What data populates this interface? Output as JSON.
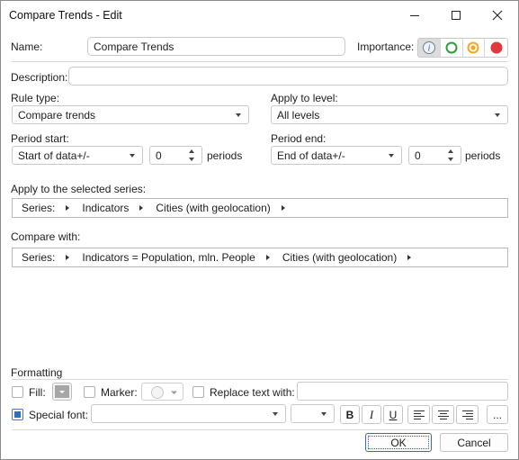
{
  "window": {
    "title": "Compare Trends - Edit"
  },
  "name": {
    "label": "Name:",
    "value": "Compare Trends"
  },
  "importance": {
    "label": "Importance:",
    "options": [
      "info",
      "green",
      "orange",
      "red"
    ]
  },
  "description": {
    "label": "Description:",
    "value": ""
  },
  "rule_type": {
    "label": "Rule type:",
    "value": "Compare trends"
  },
  "apply_level": {
    "label": "Apply to level:",
    "value": "All levels"
  },
  "period_start": {
    "label": "Period start:",
    "mode": "Start of data+/-",
    "value": "0",
    "unit": "periods"
  },
  "period_end": {
    "label": "Period end:",
    "mode": "End of data+/-",
    "value": "0",
    "unit": "periods"
  },
  "apply_series": {
    "label": "Apply to the selected series:",
    "segments": [
      "Series:",
      "Indicators",
      "Cities (with geolocation)"
    ]
  },
  "compare_with": {
    "label": "Compare with:",
    "segments": [
      "Series:",
      "Indicators = Population, mln. People",
      "Cities (with geolocation)"
    ]
  },
  "formatting": {
    "label": "Formatting",
    "fill_label": "Fill:",
    "marker_label": "Marker:",
    "replace_label": "Replace text with:",
    "replace_value": "",
    "special_font_label": "Special font:",
    "font_name": "",
    "font_size": "",
    "bold": "B",
    "italic": "I",
    "underline": "U",
    "more": "..."
  },
  "buttons": {
    "ok": "OK",
    "cancel": "Cancel"
  },
  "colors": {
    "green": "#2e9e3c",
    "orange": "#f5a623",
    "red": "#e0383e",
    "checked": "#2e6fbf"
  }
}
